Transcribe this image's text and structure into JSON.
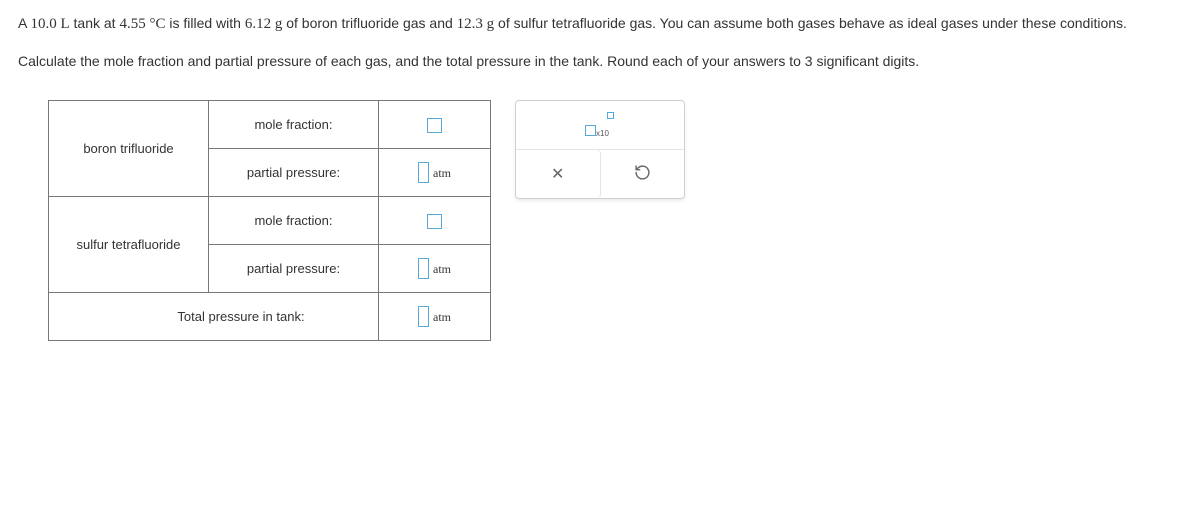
{
  "problem": {
    "pre_vol": "A ",
    "vol": "10.0 L",
    "mid1": " tank at ",
    "temp": "4.55 °C",
    "mid2": " is filled with ",
    "m1": "6.12 g",
    "mid3": " of boron trifluoride gas and ",
    "m2": "12.3 g",
    "mid4": " of sulfur tetrafluoride gas. You can assume both gases behave as ideal gases under these conditions."
  },
  "instruction": {
    "pre": "Calculate the mole fraction and partial pressure of each gas, and the total pressure in the tank. Round each of your answers to ",
    "sig": "3",
    "post": " significant digits."
  },
  "table": {
    "gas1": "boron trifluoride",
    "gas2": "sulfur tetrafluoride",
    "mole_fraction": "mole fraction:",
    "partial_pressure": "partial pressure:",
    "total_pressure": "Total pressure in tank:",
    "unit_atm": "atm"
  },
  "tools": {
    "x10": "x10"
  }
}
